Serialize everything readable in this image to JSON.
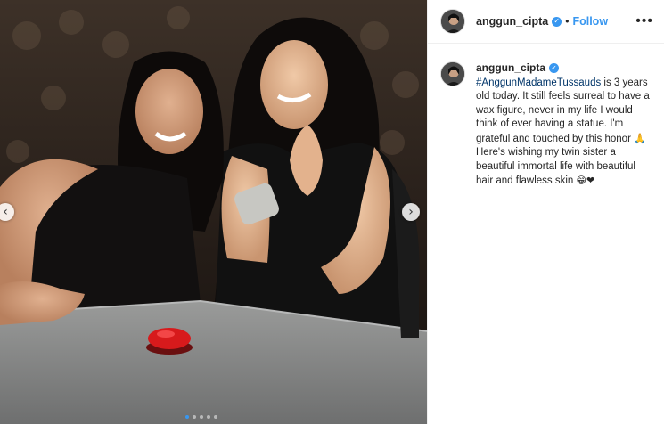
{
  "post": {
    "username": "anggun_cipta",
    "separator": "•",
    "follow_label": "Follow",
    "more_icon": "•••",
    "verified_icon": "✓"
  },
  "caption": {
    "username": "anggun_cipta",
    "hashtag": "#AnggunMadameTussauds",
    "text": " is 3 years old today. It still feels surreal to have a wax figure, never in my life I would think of ever having a statue. I'm grateful and touched by this honor ",
    "emoji_pray": "🙏",
    "text2": " Here's wishing my twin sister a beautiful immortal life with beautiful hair and flawless skin ",
    "emoji_end": "😁❤"
  },
  "carousel": {
    "prev_icon": "‹",
    "next_icon": "›",
    "total_slides": 5,
    "active_slide": 1
  },
  "colors": {
    "accent": "#3897f0",
    "hashtag": "#003569",
    "text": "#262626"
  }
}
